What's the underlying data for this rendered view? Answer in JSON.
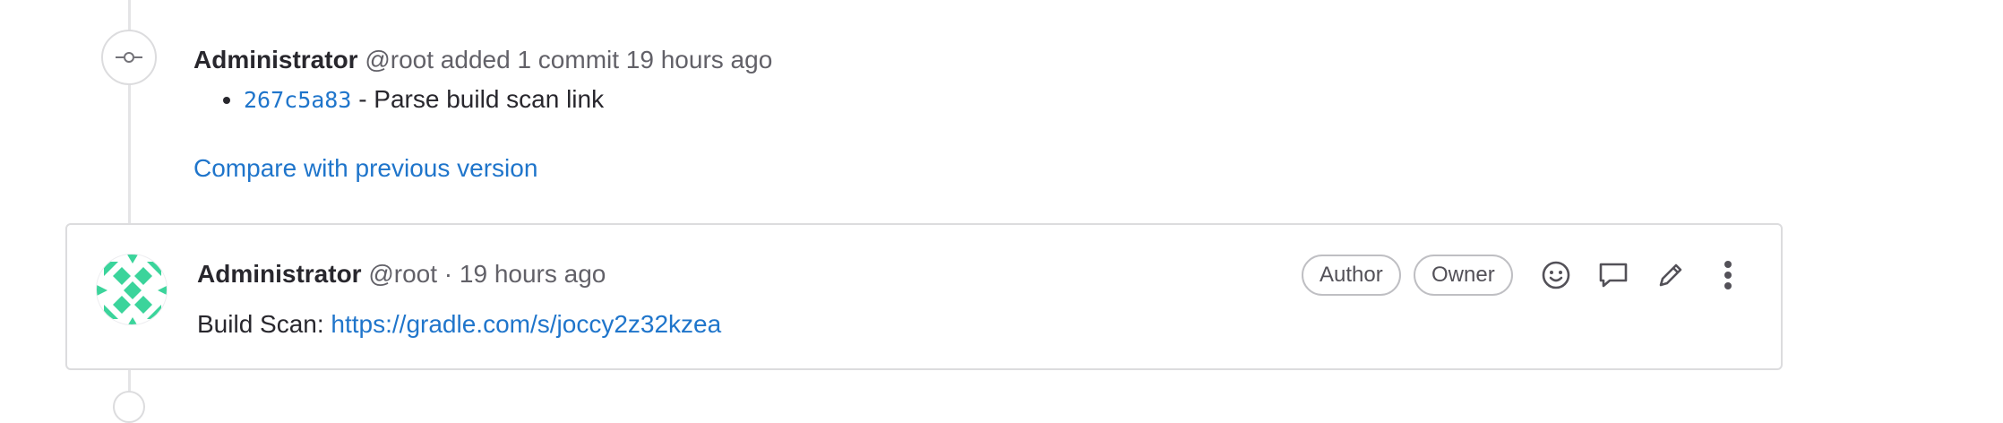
{
  "system_note": {
    "author_name": "Administrator",
    "meta": "@root added 1 commit 19 hours ago",
    "icon": "commit-icon",
    "commits": [
      {
        "sha": "267c5a83",
        "message": " - Parse build scan link"
      }
    ],
    "compare_link": "Compare with previous version"
  },
  "note": {
    "author_name": "Administrator",
    "meta": "@root · 19 hours ago",
    "body_prefix": "Build Scan: ",
    "body_link": "https://gradle.com/s/joccy2z32kzea",
    "badges": {
      "author": "Author",
      "owner": "Owner"
    },
    "actions": [
      "smile-icon",
      "comment-icon",
      "pencil-icon",
      "kebab-menu-icon"
    ]
  },
  "colors": {
    "link": "#1f75cb",
    "text": "#28272d",
    "muted": "#626168",
    "border": "#dcdcde",
    "avatar_accent": "#2ecc71"
  }
}
